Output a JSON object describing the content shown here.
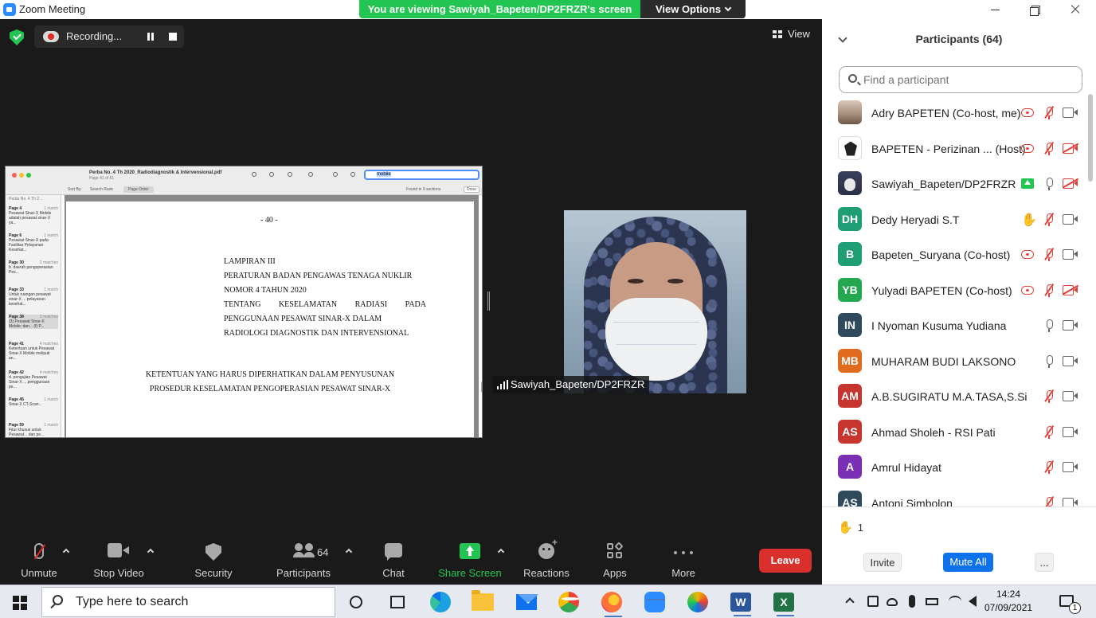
{
  "window": {
    "title": "Zoom Meeting",
    "share_banner": "You are viewing Sawiyah_Bapeten/DP2FRZR's screen",
    "view_options": "View Options"
  },
  "recording": {
    "label": "Recording..."
  },
  "view_button": {
    "label": "View"
  },
  "shared_document": {
    "filename": "Perba No. 4 Th 2020_Radiodiagnostik & Intervensional.pdf",
    "page_info": "Page 41 of 61",
    "search_value": "mobile",
    "sort_label": "Sort By:",
    "sort_search_rank": "Search Rank",
    "sort_page_order": "Page Order",
    "found_text": "Found in 9 sections",
    "done_label": "Done",
    "sidebar_title": "Perba No. 4 Th 2...",
    "results": [
      {
        "page": "Page 4",
        "matches": "1 match",
        "snippet": "Pesawat Sinar-X Mobile adalah pesawat sinar-X ya..."
      },
      {
        "page": "Page 6",
        "matches": "1 match",
        "snippet": "Pesawat Sinar-X pada Fasilitas Pelayanan Kesehat..."
      },
      {
        "page": "Page 30",
        "matches": "2 matches",
        "snippet": "b. daerah pengoperasian Pes..."
      },
      {
        "page": "Page 33",
        "matches": "1 match",
        "snippet": "Untuk ruangan pesawat sinar-X ... pelayanan kesehat..."
      },
      {
        "page": "Page 38",
        "matches": "2 matches",
        "snippet": "(3) Pesawat Sinar-X Mobile; dan... (f) P..."
      },
      {
        "page": "Page 41",
        "matches": "4 matches",
        "snippet": "Ketentuan untuk Pesawat Sinar-X Mobile meliputi an..."
      },
      {
        "page": "Page 42",
        "matches": "4 matches",
        "snippet": "d. pengujian Pesawat Sinar-X ... penggunaan pe..."
      },
      {
        "page": "Page 45",
        "matches": "1 match",
        "snippet": "Sinar-X CT-Scan..."
      },
      {
        "page": "Page 59",
        "matches": "1 match",
        "snippet": "Fitur khusus untuk Pesawat... dan pe..."
      }
    ],
    "page_number": "- 40 -",
    "header_lines": [
      "LAMPIRAN III",
      "PERATURAN BADAN PENGAWAS TENAGA NUKLIR",
      "NOMOR 4 TAHUN  2020"
    ],
    "justified_line_words": [
      "TENTANG",
      "KESELAMATAN",
      "RADIASI",
      "PADA"
    ],
    "header_lines_2": [
      "PENGGUNAAN PESAWAT SINAR-X DALAM",
      "RADIOLOGI DIAGNOSTIK DAN INTERVENSIONAL"
    ],
    "title_lines": [
      "KETENTUAN YANG HARUS DIPERHATIKAN DALAM PENYUSUNAN",
      "PROSEDUR KESELAMATAN PENGOPERASIAN PESAWAT SINAR-X"
    ]
  },
  "video": {
    "name": "Sawiyah_Bapeten/DP2FRZR"
  },
  "toolbar": {
    "unmute": "Unmute",
    "stop_video": "Stop Video",
    "security": "Security",
    "participants": "Participants",
    "participants_count": "64",
    "chat": "Chat",
    "share_screen": "Share Screen",
    "reactions": "Reactions",
    "apps": "Apps",
    "more": "More",
    "leave": "Leave"
  },
  "panel": {
    "title": "Participants (64)",
    "search_placeholder": "Find a participant",
    "participants": [
      {
        "name": "Adry BAPETEN (Co-host, me)",
        "avatar": "photo",
        "initials": "",
        "color": "",
        "recording": true,
        "sharing": false,
        "hand": false,
        "mic_muted": true,
        "video_off": false
      },
      {
        "name": "BAPETEN - Perizinan ...  (Host)",
        "avatar": "photo",
        "initials": "",
        "color": "",
        "recording": true,
        "sharing": false,
        "hand": false,
        "mic_muted": true,
        "video_off": true
      },
      {
        "name": "Sawiyah_Bapeten/DP2FRZR",
        "avatar": "photo",
        "initials": "",
        "color": "",
        "recording": false,
        "sharing": true,
        "hand": false,
        "mic_muted": false,
        "video_off": true
      },
      {
        "name": "Dedy Heryadi S.T",
        "avatar": "initials",
        "initials": "DH",
        "color": "#1f9d74",
        "recording": false,
        "sharing": false,
        "hand": true,
        "mic_muted": true,
        "video_off": false
      },
      {
        "name": "Bapeten_Suryana (Co-host)",
        "avatar": "initials",
        "initials": "B",
        "color": "#1f9d74",
        "recording": true,
        "sharing": false,
        "hand": false,
        "mic_muted": true,
        "video_off": false
      },
      {
        "name": "Yulyadi BAPETEN (Co-host)",
        "avatar": "initials",
        "initials": "YB",
        "color": "#23a84f",
        "recording": true,
        "sharing": false,
        "hand": false,
        "mic_muted": true,
        "video_off": true
      },
      {
        "name": "I Nyoman Kusuma Yudiana",
        "avatar": "initials",
        "initials": "IN",
        "color": "#2f4a5d",
        "recording": false,
        "sharing": false,
        "hand": false,
        "mic_muted": false,
        "video_off": false
      },
      {
        "name": "MUHARAM BUDI LAKSONO",
        "avatar": "initials",
        "initials": "MB",
        "color": "#e06b1d",
        "recording": false,
        "sharing": false,
        "hand": false,
        "mic_muted": false,
        "video_off": false
      },
      {
        "name": "A.B.SUGIRATU M.A.TASA,S.Si",
        "avatar": "initials",
        "initials": "AM",
        "color": "#c6362f",
        "recording": false,
        "sharing": false,
        "hand": false,
        "mic_muted": true,
        "video_off": false
      },
      {
        "name": "Ahmad Sholeh - RSI Pati",
        "avatar": "initials",
        "initials": "AS",
        "color": "#c6362f",
        "recording": false,
        "sharing": false,
        "hand": false,
        "mic_muted": true,
        "video_off": false
      },
      {
        "name": "Amrul Hidayat",
        "avatar": "initials",
        "initials": "A",
        "color": "#7a2fb5",
        "recording": false,
        "sharing": false,
        "hand": false,
        "mic_muted": true,
        "video_off": false
      },
      {
        "name": "Antoni Simbolon",
        "avatar": "initials",
        "initials": "AS",
        "color": "#2f4a5d",
        "recording": false,
        "sharing": false,
        "hand": false,
        "mic_muted": true,
        "video_off": false
      }
    ],
    "raised_hands": "1",
    "invite": "Invite",
    "mute_all": "Mute All",
    "more": "..."
  },
  "taskbar": {
    "search_placeholder": "Type here to search",
    "time": "14:24",
    "date": "07/09/2021",
    "notification_count": "1",
    "word_letter": "W",
    "excel_letter": "X"
  }
}
